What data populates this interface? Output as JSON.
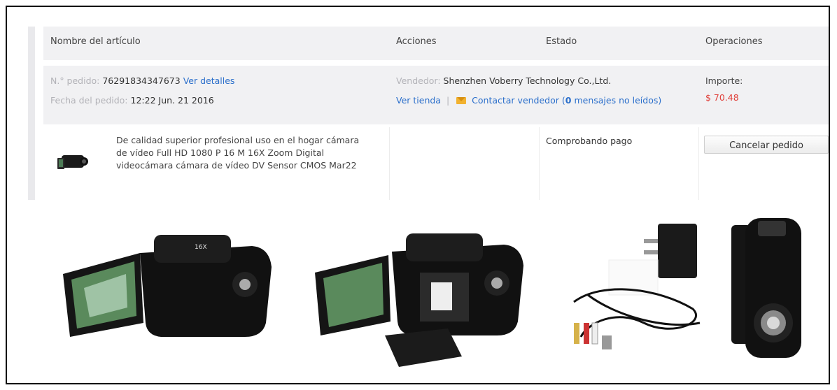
{
  "headers": {
    "item_name": "Nombre del artículo",
    "actions": "Acciones",
    "status": "Estado",
    "operations": "Operaciones"
  },
  "order": {
    "number_label": "N.° pedido:",
    "number": "76291834347673",
    "details_link": "Ver detalles",
    "date_label": "Fecha del pedido:",
    "date": "12:22 Jun. 21 2016",
    "seller_label": "Vendedor:",
    "seller": "Shenzhen Voberry Technology Co.,Ltd.",
    "store_link": "Ver tienda",
    "separator": "|",
    "contact_link": "Contactar vendedor",
    "unread_open": "(",
    "unread_count": "0",
    "unread_text": "mensajes no leídos)",
    "amount_label": "Importe:",
    "amount": "$ 70.48"
  },
  "item": {
    "title": "De calidad superior profesional uso en el hogar cámara de vídeo Full HD 1080 P 16 M 16X Zoom Digital videocámara cámara de vídeo DV Sensor CMOS Mar22",
    "status": "Comprobando pago",
    "cancel_label": "Cancelar pedido",
    "camera_badge": "16X"
  },
  "colors": {
    "link": "#2b6fcb",
    "price": "#e0403a",
    "header_bg": "#f1f1f3"
  }
}
